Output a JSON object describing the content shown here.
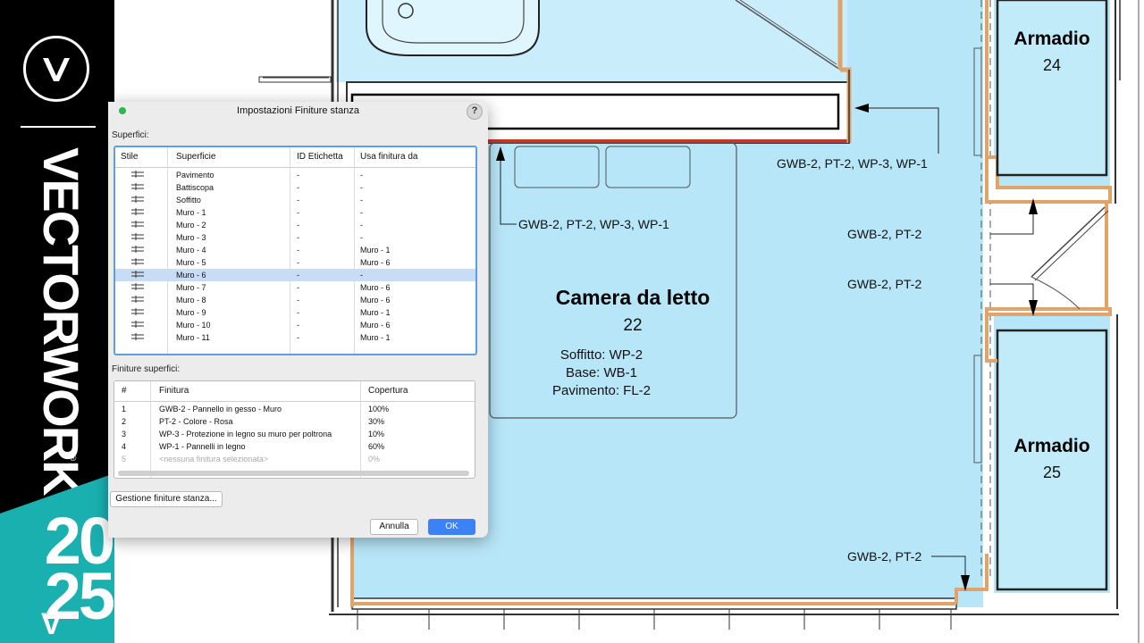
{
  "brand": {
    "wordmark": "VECTORWORKS",
    "reg": "®",
    "year_top": "20",
    "year_bottom": "25",
    "version_prefix": "V"
  },
  "plan": {
    "rooms": [
      {
        "name": "Camera da letto",
        "number": "22",
        "specs": [
          "Soffitto: WP-2",
          "Base: WB-1",
          "Pavimento: FL-2"
        ]
      },
      {
        "name": "Armadio",
        "number": "24"
      },
      {
        "name": "Armadio",
        "number": "25"
      }
    ],
    "callouts": [
      "GWB-2, PT-2, WP-3, WP-1",
      "GWB-2, PT-2, WP-3, WP-1",
      "GWB-2, PT-2",
      "GWB-2, PT-2",
      "GWB-2, PT-2"
    ]
  },
  "dialog": {
    "title": "Impostazioni Finiture stanza",
    "help": "?",
    "surfaces_label": "Superfici:",
    "surfaces_columns": [
      "Stile",
      "Superficie",
      "ID Etichetta",
      "Usa finitura da"
    ],
    "surfaces_rows": [
      {
        "surface": "Pavimento",
        "id": "-",
        "use": "-"
      },
      {
        "surface": "Battiscopa",
        "id": "-",
        "use": "-"
      },
      {
        "surface": "Soffitto",
        "id": "-",
        "use": "-"
      },
      {
        "surface": "Muro - 1",
        "id": "-",
        "use": "-"
      },
      {
        "surface": "Muro - 2",
        "id": "-",
        "use": "-"
      },
      {
        "surface": "Muro - 3",
        "id": "-",
        "use": "-"
      },
      {
        "surface": "Muro - 4",
        "id": "-",
        "use": "Muro - 1"
      },
      {
        "surface": "Muro - 5",
        "id": "-",
        "use": "Muro - 6"
      },
      {
        "surface": "Muro - 6",
        "id": "-",
        "use": "-",
        "selected": true
      },
      {
        "surface": "Muro - 7",
        "id": "-",
        "use": "Muro - 6"
      },
      {
        "surface": "Muro - 8",
        "id": "-",
        "use": "Muro - 6"
      },
      {
        "surface": "Muro - 9",
        "id": "-",
        "use": "Muro - 1"
      },
      {
        "surface": "Muro - 10",
        "id": "-",
        "use": "Muro - 6"
      },
      {
        "surface": "Muro - 11",
        "id": "-",
        "use": "Muro - 1"
      }
    ],
    "finishes_label": "Finiture superfici:",
    "finishes_columns": [
      "#",
      "Finitura",
      "Copertura"
    ],
    "finishes_rows": [
      {
        "n": "1",
        "finish": "GWB-2 - Pannello in gesso - Muro",
        "coverage": "100%"
      },
      {
        "n": "2",
        "finish": "PT-2 - Colore - Rosa",
        "coverage": "30%"
      },
      {
        "n": "3",
        "finish": "WP-3 - Protezione in legno su muro per poltrona",
        "coverage": "10%"
      },
      {
        "n": "4",
        "finish": "WP-1 - Pannelli in legno",
        "coverage": "60%"
      },
      {
        "n": "5",
        "finish": "<nessuna finitura selezionata>",
        "coverage": "0%",
        "dim": true
      }
    ],
    "manage_button": "Gestione finiture stanza...",
    "cancel_button": "Annulla",
    "ok_button": "OK"
  },
  "colors": {
    "floor": "#b7e6f8",
    "wall_finish": "#e0a36a",
    "selected_wall": "#c0392b",
    "accent": "#3b82f6",
    "teal": "#1bb0b0"
  }
}
